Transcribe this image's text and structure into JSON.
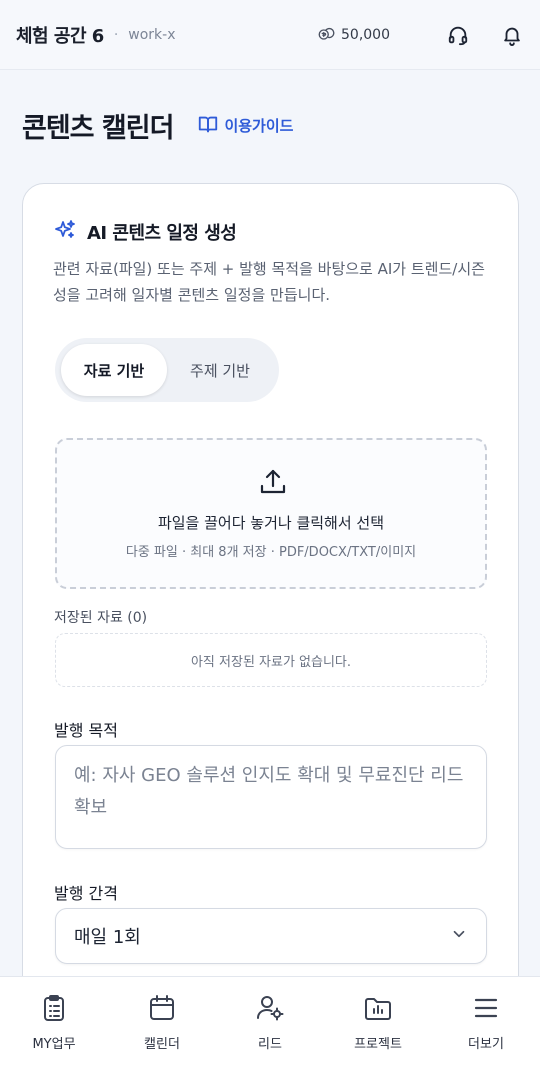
{
  "header": {
    "workspace_name": "체험 공간 6",
    "separator": "·",
    "workspace_id": "work-x",
    "credits": "50,000"
  },
  "page": {
    "title": "콘텐츠 캘린더",
    "guide_label": "이용가이드"
  },
  "card": {
    "title": "AI 콘텐츠 일정 생성",
    "description": "관련 자료(파일) 또는 주제 + 발행 목적을 바탕으로 AI가 트렌드/시즌성을 고려해 일자별 콘텐츠 일정을 만듭니다.",
    "tabs": [
      {
        "label": "자료 기반",
        "active": true
      },
      {
        "label": "주제 기반",
        "active": false
      }
    ],
    "dropzone": {
      "title": "파일을 끌어다 놓거나 클릭해서 선택",
      "subtitle": "다중 파일 · 최대 8개 저장 · PDF/DOCX/TXT/이미지"
    },
    "saved": {
      "label": "저장된 자료 (0)",
      "empty_text": "아직 저장된 자료가 없습니다."
    },
    "purpose": {
      "label": "발행 목적",
      "placeholder": "예: 자사 GEO 솔루션 인지도 확대 및 무료진단 리드 확보"
    },
    "interval": {
      "label": "발행 간격",
      "value": "매일 1회"
    }
  },
  "bottom_nav": [
    {
      "label": "MY업무",
      "icon": "clipboard-icon"
    },
    {
      "label": "캘린더",
      "icon": "calendar-icon"
    },
    {
      "label": "리드",
      "icon": "user-gear-icon"
    },
    {
      "label": "프로젝트",
      "icon": "folder-chart-icon"
    },
    {
      "label": "더보기",
      "icon": "menu-icon"
    }
  ],
  "colors": {
    "accent": "#2f5bd8",
    "background": "#f3f6fb"
  }
}
